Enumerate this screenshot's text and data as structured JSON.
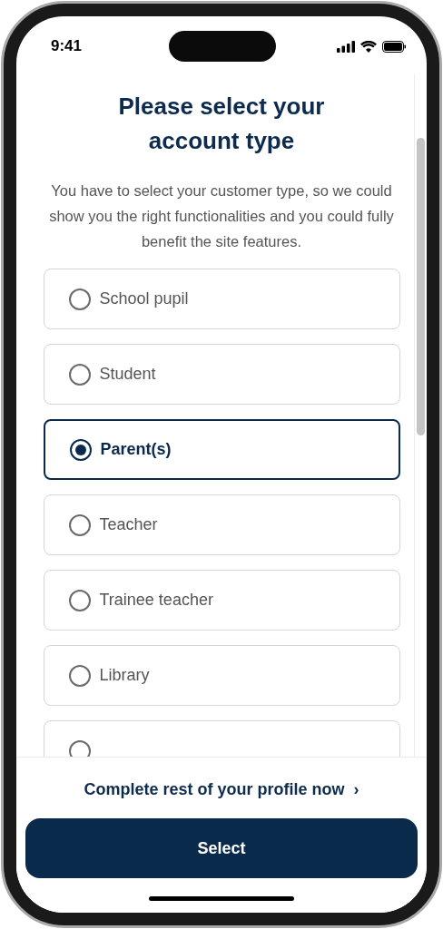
{
  "status_bar": {
    "time": "9:41"
  },
  "title": "Please select your account type",
  "description": "You have to select your customer type, so we could show you the right functionalities and you could fully benefit the site features.",
  "options": [
    {
      "label": "School pupil",
      "selected": false
    },
    {
      "label": "Student",
      "selected": false
    },
    {
      "label": "Parent(s)",
      "selected": true
    },
    {
      "label": "Teacher",
      "selected": false
    },
    {
      "label": "Trainee teacher",
      "selected": false
    },
    {
      "label": "Library",
      "selected": false
    },
    {
      "selected": false
    }
  ],
  "footer": {
    "link": "Complete rest of your profile now",
    "link_icon": "›",
    "button": "Select"
  }
}
